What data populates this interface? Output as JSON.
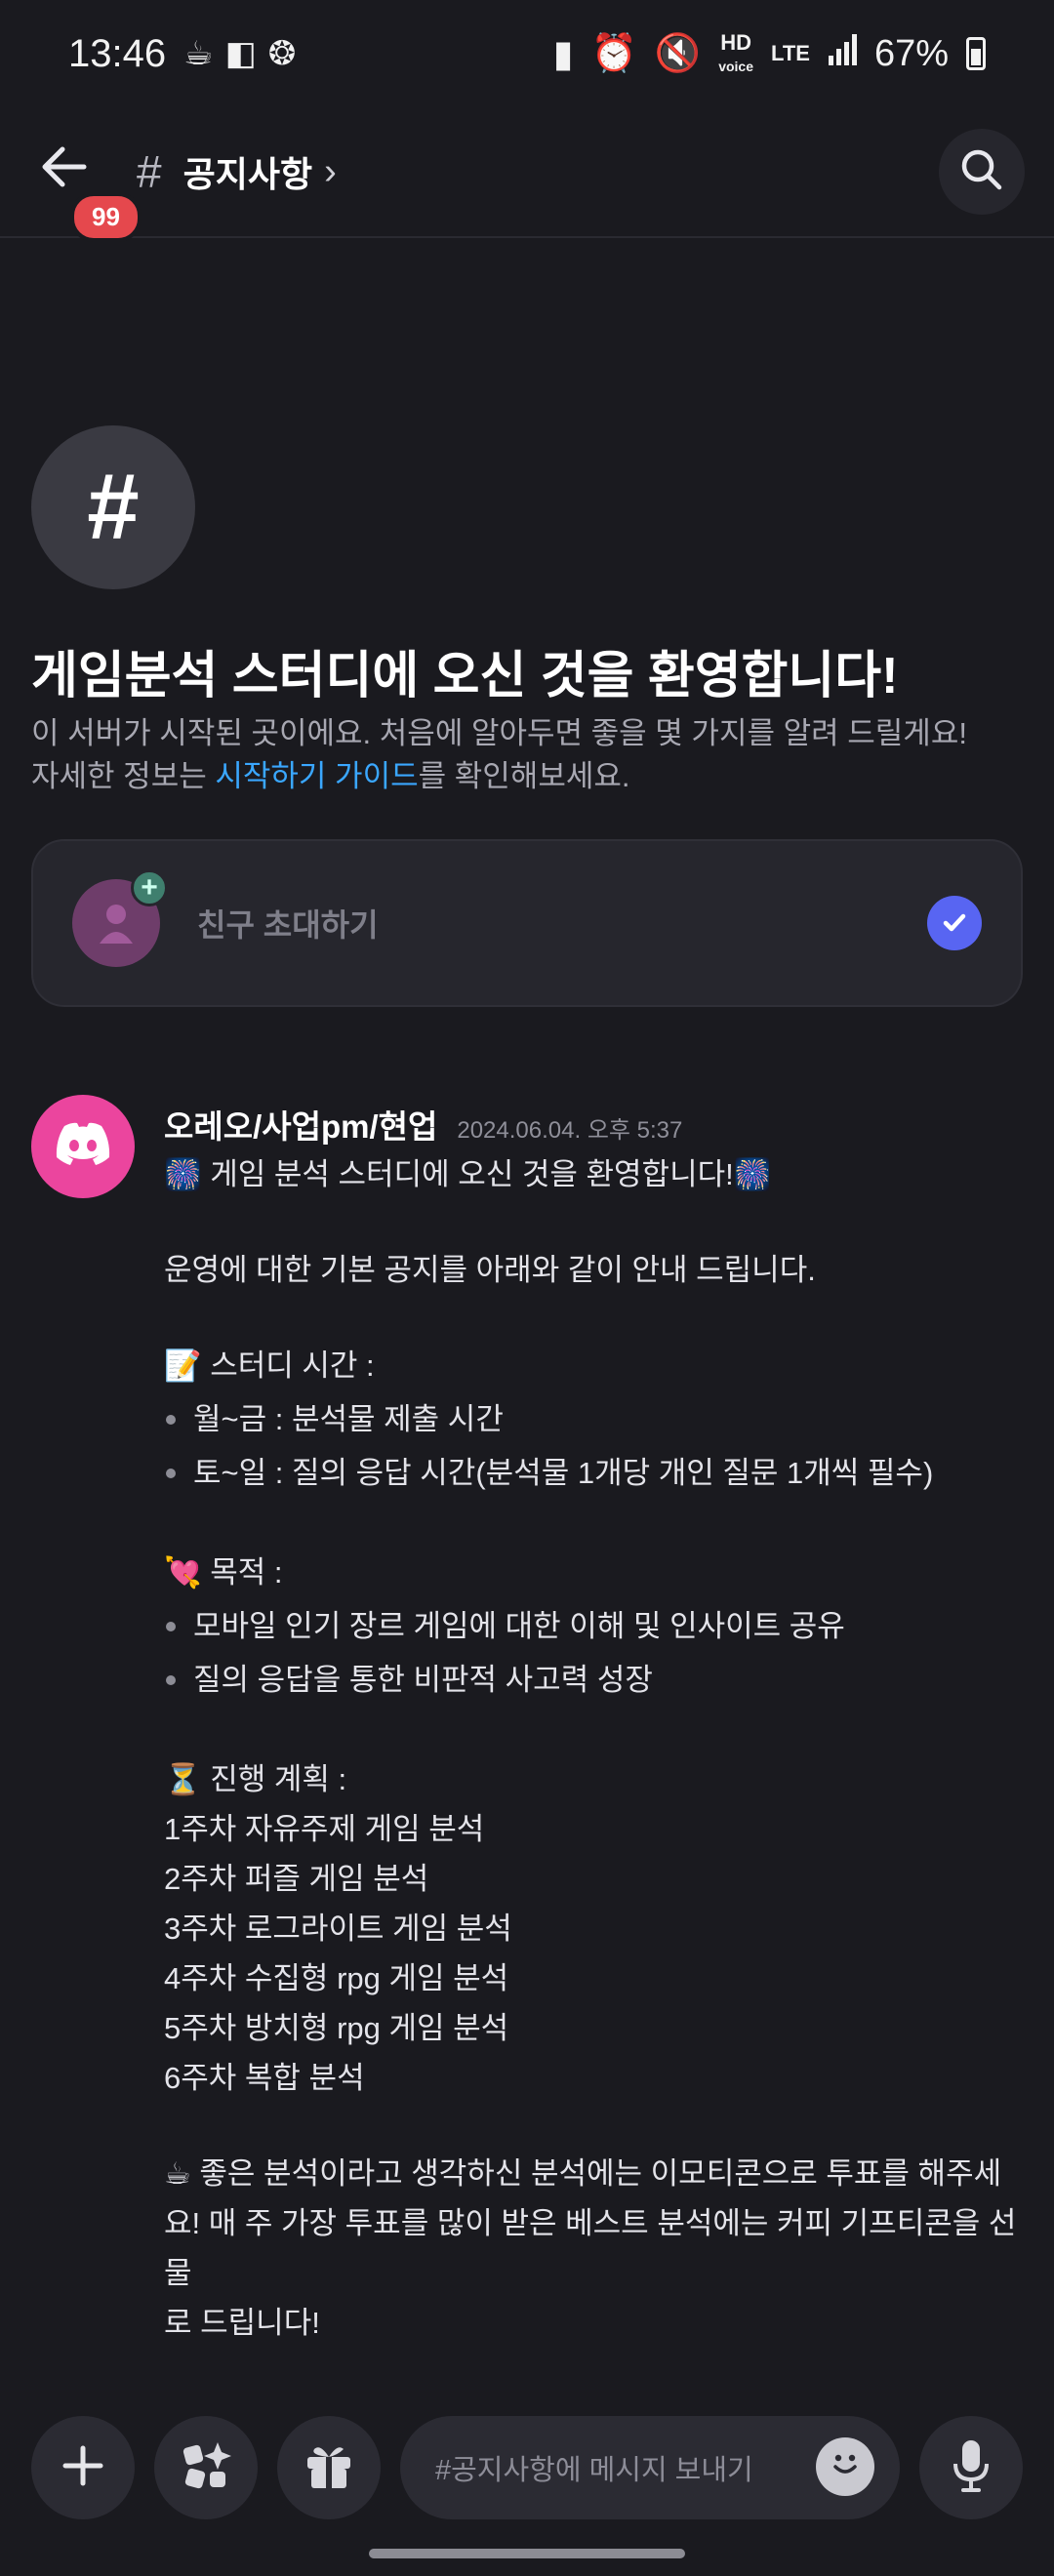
{
  "status_bar": {
    "time": "13:46",
    "left_icons": [
      "coffee-icon",
      "app-icon",
      "settings-ring-icon"
    ],
    "right_icons": [
      "battery-saver-icon",
      "alarm-icon",
      "mute-icon",
      "hd-voice-icon",
      "lte-icon",
      "signal-icon"
    ],
    "hd_label": "HD",
    "voice_label": "voice",
    "lte_label": "LTE",
    "battery": "67%"
  },
  "header": {
    "badge": "99",
    "hash": "#",
    "channel_name": "공지사항",
    "chevron": "›"
  },
  "welcome": {
    "icon": "#",
    "title": "게임분석 스터디에 오신 것을 환영합니다!",
    "desc_line1": "이 서버가 시작된 곳이에요. 처음에 알아두면 좋을 몇 가지를 알려    드릴게요!",
    "desc_prefix": "자세한 정보는 ",
    "desc_link": "시작하기 가이드",
    "desc_suffix": "를 확인해보세요."
  },
  "invite": {
    "label": "친구 초대하기",
    "plus": "+"
  },
  "message": {
    "author": "오레오/사업pm/현업",
    "timestamp": "2024.06.04. 오후 5:37",
    "line_welcome": "🎆 게임 분석 스터디에 오신 것을 환영합니다!🎆",
    "line_intro": "운영에 대한 기본 공지를 아래와 같이 안내 드립니다.",
    "study_time_heading": "📝 스터디 시간 :",
    "study_time_items": [
      "월~금 : 분석물 제출 시간",
      "토~일 : 질의 응답 시간(분석물 1개당 개인 질문 1개씩 필수)"
    ],
    "purpose_heading": "💘 목적 :",
    "purpose_items": [
      "모바일 인기 장르 게임에 대한 이해 및 인사이트 공유",
      "질의 응답을 통한 비판적 사고력 성장"
    ],
    "plan_heading": "⏳ 진행 계획 :",
    "plan_items": [
      "1주차 자유주제 게임 분석",
      "2주차 퍼즐 게임 분석",
      "3주차 로그라이트 게임 분석",
      "4주차 수집형 rpg 게임 분석",
      "5주차 방치형 rpg 게임 분석",
      "6주차 복합 분석"
    ],
    "closing_line1": "☕ 좋은 분석이라고 생각하신 분석에는 이모티콘으로 투표를 해주세",
    "closing_line2": "요! 매 주 가장 투표를 많이 받은 베스트 분석에는 커피 기프티콘을 선물",
    "closing_line3": "로 드립니다!"
  },
  "composer": {
    "placeholder": "#공지사항에 메시지 보내기"
  },
  "colors": {
    "background": "#1a1a1f",
    "accent": "#5865f2",
    "link": "#3aa7ff",
    "badge": "#e5484d",
    "avatar": "#eb459e"
  }
}
